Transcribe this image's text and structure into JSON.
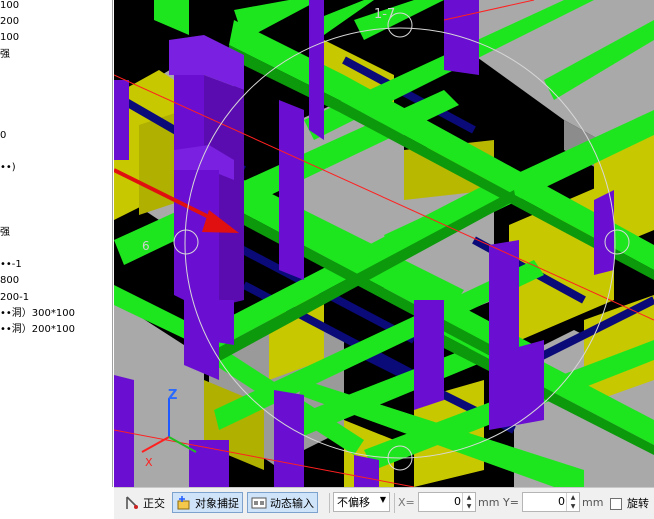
{
  "left_panel": {
    "lines": [
      "100",
      "200",
      "100",
      "强",
      "",
      "",
      "",
      "",
      "0",
      "",
      "••)",
      "",
      "",
      "",
      "强",
      "",
      "••-1",
      "800",
      "200-1",
      "••洞）300*100",
      "••洞）200*100"
    ]
  },
  "viewport": {
    "label_top": "1-7",
    "label_left": "6",
    "axis_z": "Z",
    "axis_x": "X",
    "colors": {
      "beam_green": "#1ee61e",
      "column_purple": "#6a0fd2",
      "wall_gray": "#a9a9a9",
      "slab_yellow": "#c8c800",
      "rebar_blue": "#0a0a78",
      "arrow_red": "#e01010"
    }
  },
  "statusbar": {
    "ortho_label": "正交",
    "snap_label": "对象捕捉",
    "dynamic_label": "动态输入",
    "offset_value": "不偏移",
    "x_label": "X=",
    "x_value": "0",
    "x_unit": "mm",
    "y_label": "Y=",
    "y_value": "0",
    "y_unit": "mm",
    "rotate_label": "旋转"
  }
}
